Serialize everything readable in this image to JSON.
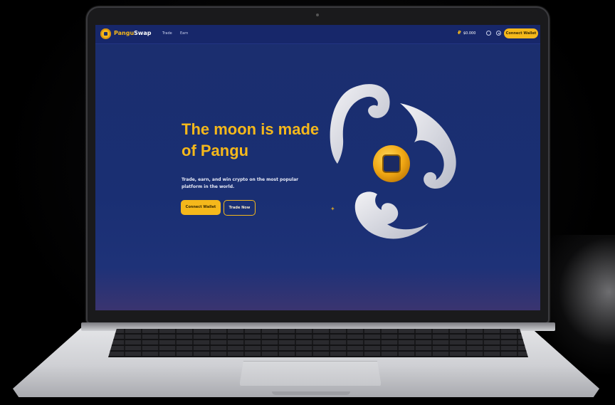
{
  "topbar": {
    "brand_left": "Pangu",
    "brand_right": "Swap",
    "nav_items": [
      "Trade",
      "Earn"
    ],
    "price": "$0.000",
    "connect_label": "Connect Wallet"
  },
  "hero": {
    "headline": "The moon is made of Pangu",
    "subtext": "Trade, earn, and win crypto on the most popular platform in the world.",
    "primary_button": "Connect Wallet",
    "secondary_button": "Trade Now"
  },
  "icons": {
    "logo": "pangu-coin-logo",
    "price": "pangu-token-icon",
    "globe": "globe-icon",
    "settings": "gear-icon"
  },
  "colors": {
    "accent": "#f5b81b",
    "screen_bg": "#1b2e6e",
    "topbar_bg": "#17276a"
  }
}
